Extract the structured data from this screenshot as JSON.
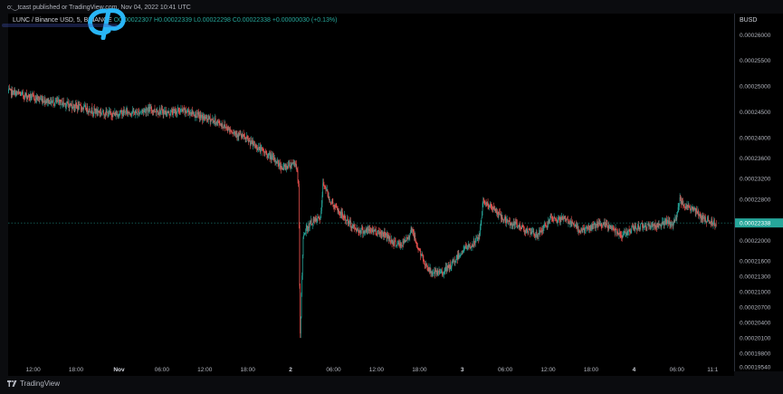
{
  "header": {
    "published_text": "o:‿tcast published or TradingView.com, Nov 04, 2022 10:41 UTC"
  },
  "legend": {
    "symbol": "LUNC / Binance USD, 5, BINANCE",
    "ohlc": "O0.00022307 H0.00022339 L0.00022298 C0.00022338 +0.00000030 (+0.13%)"
  },
  "price_axis": {
    "unit": "BUSD",
    "current_price_label": "0.00022338"
  },
  "footer": {
    "brand": "TradingView"
  },
  "colors": {
    "up": "#26a69a",
    "down": "#ef5350",
    "background": "#000000",
    "current_price_badge": "#26a69a",
    "watermark": "#29b6f6"
  },
  "icons": {
    "watermark": "cp-logo-icon",
    "brand": "tradingview-logo-icon"
  },
  "chart_data": {
    "type": "candlestick",
    "title": "",
    "xlabel": "",
    "ylabel": "",
    "grid": false,
    "legend": "top-left",
    "ylim": [
      0.000195,
      0.00026
    ],
    "y_ticks": [
      "0.00026000",
      "0.00025500",
      "0.00025000",
      "0.00024500",
      "0.00024000",
      "0.00023600",
      "0.00023200",
      "0.00022800",
      "0.00022338",
      "0.00022000",
      "0.00021600",
      "0.00021300",
      "0.00021000",
      "0.00020700",
      "0.00020400",
      "0.00020100",
      "0.00019800",
      "0.00019540"
    ],
    "x_ticks": [
      "12:00",
      "18:00",
      "Nov",
      "06:00",
      "12:00",
      "18:00",
      "2",
      "06:00",
      "12:00",
      "18:00",
      "3",
      "06:00",
      "12:00",
      "18:00",
      "4",
      "06:00",
      "11:1"
    ],
    "x_tick_times": [
      12,
      18,
      24,
      30,
      36,
      42,
      48,
      54,
      60,
      66,
      72,
      78,
      84,
      90,
      96,
      102,
      107
    ],
    "xlim_hours": [
      8.5,
      110
    ],
    "current_price": 0.00022338,
    "path": [
      [
        8.5,
        0.000249
      ],
      [
        10,
        0.0002485
      ],
      [
        11.5,
        0.000248
      ],
      [
        13,
        0.0002475
      ],
      [
        14.5,
        0.000247
      ],
      [
        16,
        0.0002468
      ],
      [
        17.5,
        0.0002462
      ],
      [
        19,
        0.0002458
      ],
      [
        20.5,
        0.0002452
      ],
      [
        22,
        0.0002448
      ],
      [
        23.5,
        0.0002445
      ],
      [
        25,
        0.000245
      ],
      [
        26.5,
        0.0002448
      ],
      [
        28,
        0.0002455
      ],
      [
        29.5,
        0.0002452
      ],
      [
        31,
        0.0002448
      ],
      [
        32.5,
        0.0002452
      ],
      [
        34,
        0.000245
      ],
      [
        35.5,
        0.000244
      ],
      [
        37,
        0.0002435
      ],
      [
        38.5,
        0.0002425
      ],
      [
        40,
        0.0002412
      ],
      [
        41.5,
        0.00024
      ],
      [
        43,
        0.0002385
      ],
      [
        44.5,
        0.000237
      ],
      [
        46,
        0.0002355
      ],
      [
        47,
        0.000234
      ],
      [
        48,
        0.0002348
      ],
      [
        48.6,
        0.0002352
      ],
      [
        48.9,
        0.0002346
      ],
      [
        49.2,
        0.00023
      ],
      [
        49.4,
        0.000201
      ],
      [
        49.6,
        0.00021
      ],
      [
        49.8,
        0.00022
      ],
      [
        50.2,
        0.000222
      ],
      [
        51,
        0.0002235
      ],
      [
        51.8,
        0.000224
      ],
      [
        52.3,
        0.0002245
      ],
      [
        52.6,
        0.000231
      ],
      [
        52.9,
        0.0002305
      ],
      [
        53.5,
        0.000228
      ],
      [
        54.5,
        0.000226
      ],
      [
        55.5,
        0.0002245
      ],
      [
        56.5,
        0.000223
      ],
      [
        57.5,
        0.000222
      ],
      [
        58.5,
        0.0002218
      ],
      [
        59.5,
        0.000222
      ],
      [
        60.5,
        0.0002215
      ],
      [
        61.5,
        0.000221
      ],
      [
        62.5,
        0.0002195
      ],
      [
        63.5,
        0.000219
      ],
      [
        64.5,
        0.0002205
      ],
      [
        65,
        0.0002225
      ],
      [
        65.5,
        0.00022
      ],
      [
        66.5,
        0.0002165
      ],
      [
        67.5,
        0.000214
      ],
      [
        68.5,
        0.0002135
      ],
      [
        69.5,
        0.000214
      ],
      [
        70.5,
        0.000215
      ],
      [
        71.5,
        0.000217
      ],
      [
        72.5,
        0.0002185
      ],
      [
        73.5,
        0.000219
      ],
      [
        74.5,
        0.000221
      ],
      [
        75,
        0.000228
      ],
      [
        75.5,
        0.000227
      ],
      [
        76.5,
        0.000226
      ],
      [
        77.5,
        0.0002245
      ],
      [
        78.5,
        0.0002235
      ],
      [
        79.5,
        0.000223
      ],
      [
        80.5,
        0.0002225
      ],
      [
        81.5,
        0.0002215
      ],
      [
        82.5,
        0.000221
      ],
      [
        83.5,
        0.0002225
      ],
      [
        84.5,
        0.000224
      ],
      [
        85.5,
        0.000224
      ],
      [
        86.5,
        0.0002242
      ],
      [
        87.5,
        0.000223
      ],
      [
        88.5,
        0.000222
      ],
      [
        89.5,
        0.0002222
      ],
      [
        90.5,
        0.0002228
      ],
      [
        91.5,
        0.000223
      ],
      [
        92.5,
        0.0002228
      ],
      [
        93.5,
        0.000222
      ],
      [
        94.5,
        0.000221
      ],
      [
        95.5,
        0.000222
      ],
      [
        96.5,
        0.0002225
      ],
      [
        97.5,
        0.000223
      ],
      [
        98.5,
        0.0002228
      ],
      [
        99.5,
        0.000223
      ],
      [
        100.5,
        0.0002235
      ],
      [
        101.5,
        0.000223
      ],
      [
        102,
        0.0002245
      ],
      [
        102.5,
        0.000228
      ],
      [
        103.5,
        0.0002265
      ],
      [
        104.5,
        0.000226
      ],
      [
        105.5,
        0.0002245
      ],
      [
        106.5,
        0.0002238
      ],
      [
        107.5,
        0.00022338
      ]
    ]
  }
}
